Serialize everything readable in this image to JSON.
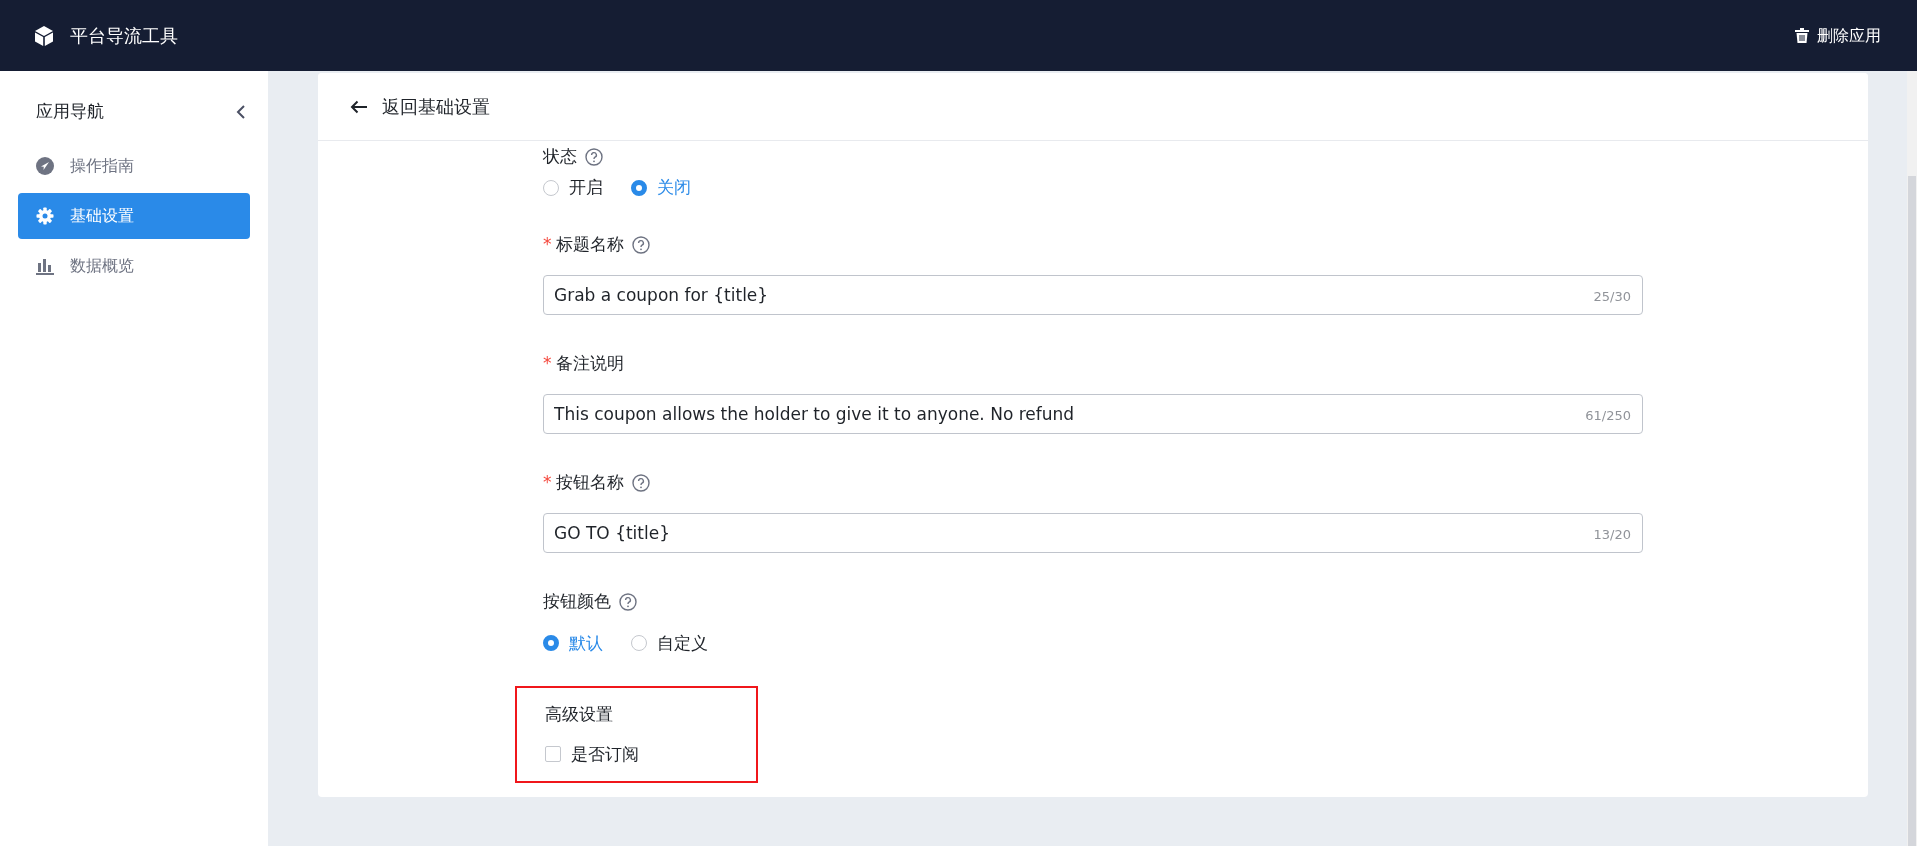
{
  "header": {
    "app_title": "平台导流工具",
    "delete_action": "删除应用"
  },
  "sidebar": {
    "title": "应用导航",
    "items": [
      {
        "label": "操作指南",
        "selected": false
      },
      {
        "label": "基础设置",
        "selected": true
      },
      {
        "label": "数据概览",
        "selected": false
      }
    ]
  },
  "page": {
    "back_label": "返回基础设置"
  },
  "form": {
    "fields": [
      {
        "kind": "radio",
        "label": "状态",
        "help": true,
        "options": [
          {
            "label": "开启",
            "selected": false
          },
          {
            "label": "关闭",
            "selected": true
          }
        ]
      },
      {
        "kind": "text",
        "required_mark": "*",
        "label": "标题名称",
        "help": true,
        "value": "Grab a coupon for {title}",
        "counter": "25/30"
      },
      {
        "kind": "text",
        "required_mark": "*",
        "label": "备注说明",
        "help": false,
        "value": "This coupon allows the holder to give it to anyone. No refund",
        "counter": "61/250"
      },
      {
        "kind": "text",
        "required_mark": "*",
        "label": "按钮名称",
        "help": true,
        "value": "GO TO {title}",
        "counter": "13/20"
      },
      {
        "kind": "radio",
        "label": "按钮颜色",
        "help": true,
        "options": [
          {
            "label": "默认",
            "selected": true
          },
          {
            "label": "自定义",
            "selected": false
          }
        ]
      }
    ],
    "advanced": {
      "title": "高级设置",
      "highlighted": true,
      "options": [
        {
          "label": "是否订阅",
          "checked": false
        }
      ]
    }
  }
}
